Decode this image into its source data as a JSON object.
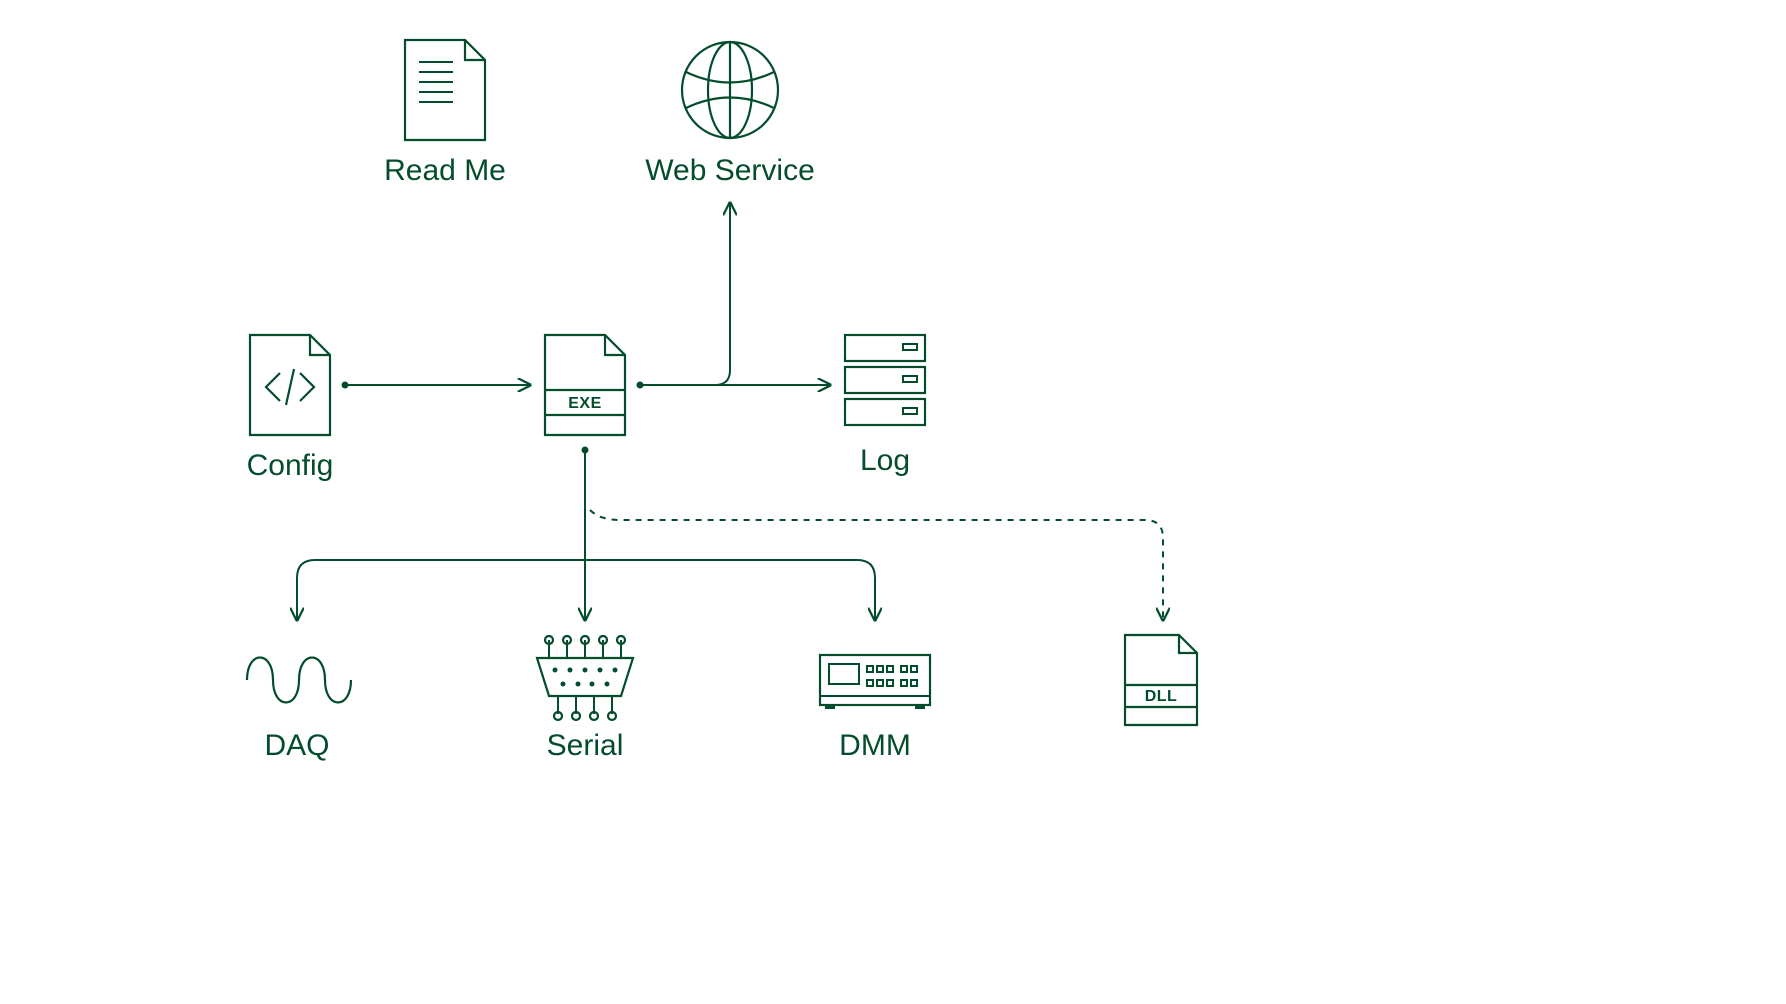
{
  "nodes": {
    "readme": {
      "label": "Read Me"
    },
    "web": {
      "label": "Web Service"
    },
    "config": {
      "label": "Config"
    },
    "exe": {
      "badge": "EXE"
    },
    "log": {
      "label": "Log"
    },
    "daq": {
      "label": "DAQ"
    },
    "serial": {
      "label": "Serial"
    },
    "dmm": {
      "label": "DMM"
    },
    "dll": {
      "badge": "DLL"
    }
  },
  "color": "#044d2c"
}
